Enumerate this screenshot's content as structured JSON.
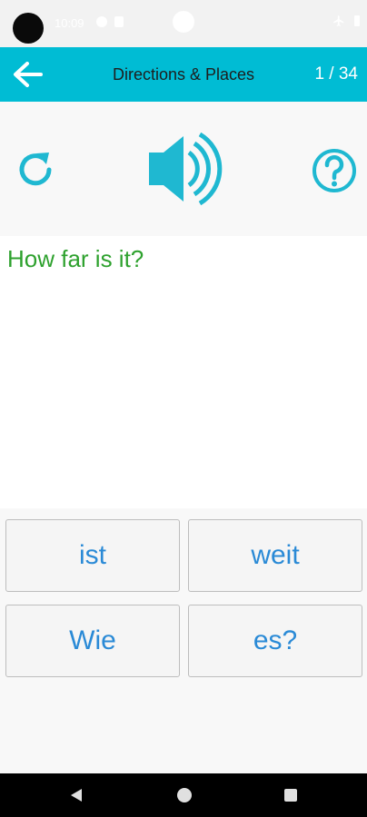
{
  "status_bar": {
    "time": "10:09"
  },
  "app_bar": {
    "title": "Directions & Places",
    "counter": "1 / 34",
    "color": "#00bcd4"
  },
  "controls": {
    "replay_icon": "replay-icon",
    "speaker_icon": "speaker-icon",
    "help_icon": "help-icon",
    "accent": "#1fb8d1"
  },
  "prompt": {
    "text": "How far is it?",
    "color": "#2ea12e"
  },
  "tiles": [
    {
      "label": "ist"
    },
    {
      "label": "weit"
    },
    {
      "label": "Wie"
    },
    {
      "label": "es?"
    }
  ],
  "tile_text_color": "#2a8ad6"
}
